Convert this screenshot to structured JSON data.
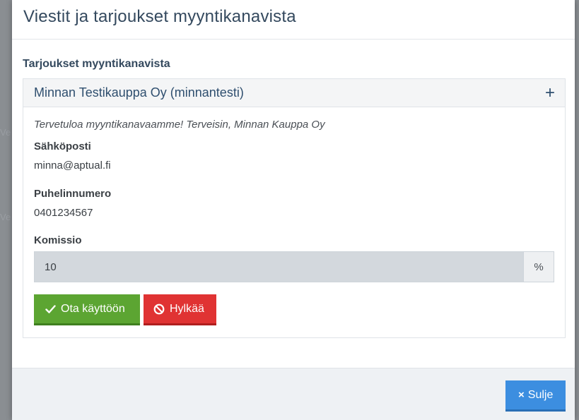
{
  "backdrop": {
    "fragment_1": "Ve",
    "fragment_2": "Ve"
  },
  "modal": {
    "title": "Viestit ja tarjoukset myyntikanavista",
    "section_title": "Tarjoukset myyntikanavista",
    "offer": {
      "heading": "Minnan Testikauppa Oy (minnantesti)",
      "expand_icon": "+",
      "greeting": "Tervetuloa myyntikanavaamme! Terveisin, Minnan Kauppa Oy",
      "email_label": "Sähköposti",
      "email_value": "minna@aptual.fi",
      "phone_label": "Puhelinnumero",
      "phone_value": "0401234567",
      "commission_label": "Komissio",
      "commission_value": "10",
      "commission_unit": "%",
      "accept_label": "Ota käyttöön",
      "reject_label": "Hylkää"
    },
    "footer": {
      "close_label": "Sulje",
      "close_icon": "×"
    }
  },
  "colors": {
    "accept": "#5ca532",
    "reject": "#e03333",
    "primary": "#3c8ee0",
    "title": "#34495e"
  },
  "icons": {
    "accept": "check-icon",
    "reject": "ban-icon",
    "close": "close-icon",
    "expand": "plus-icon"
  }
}
